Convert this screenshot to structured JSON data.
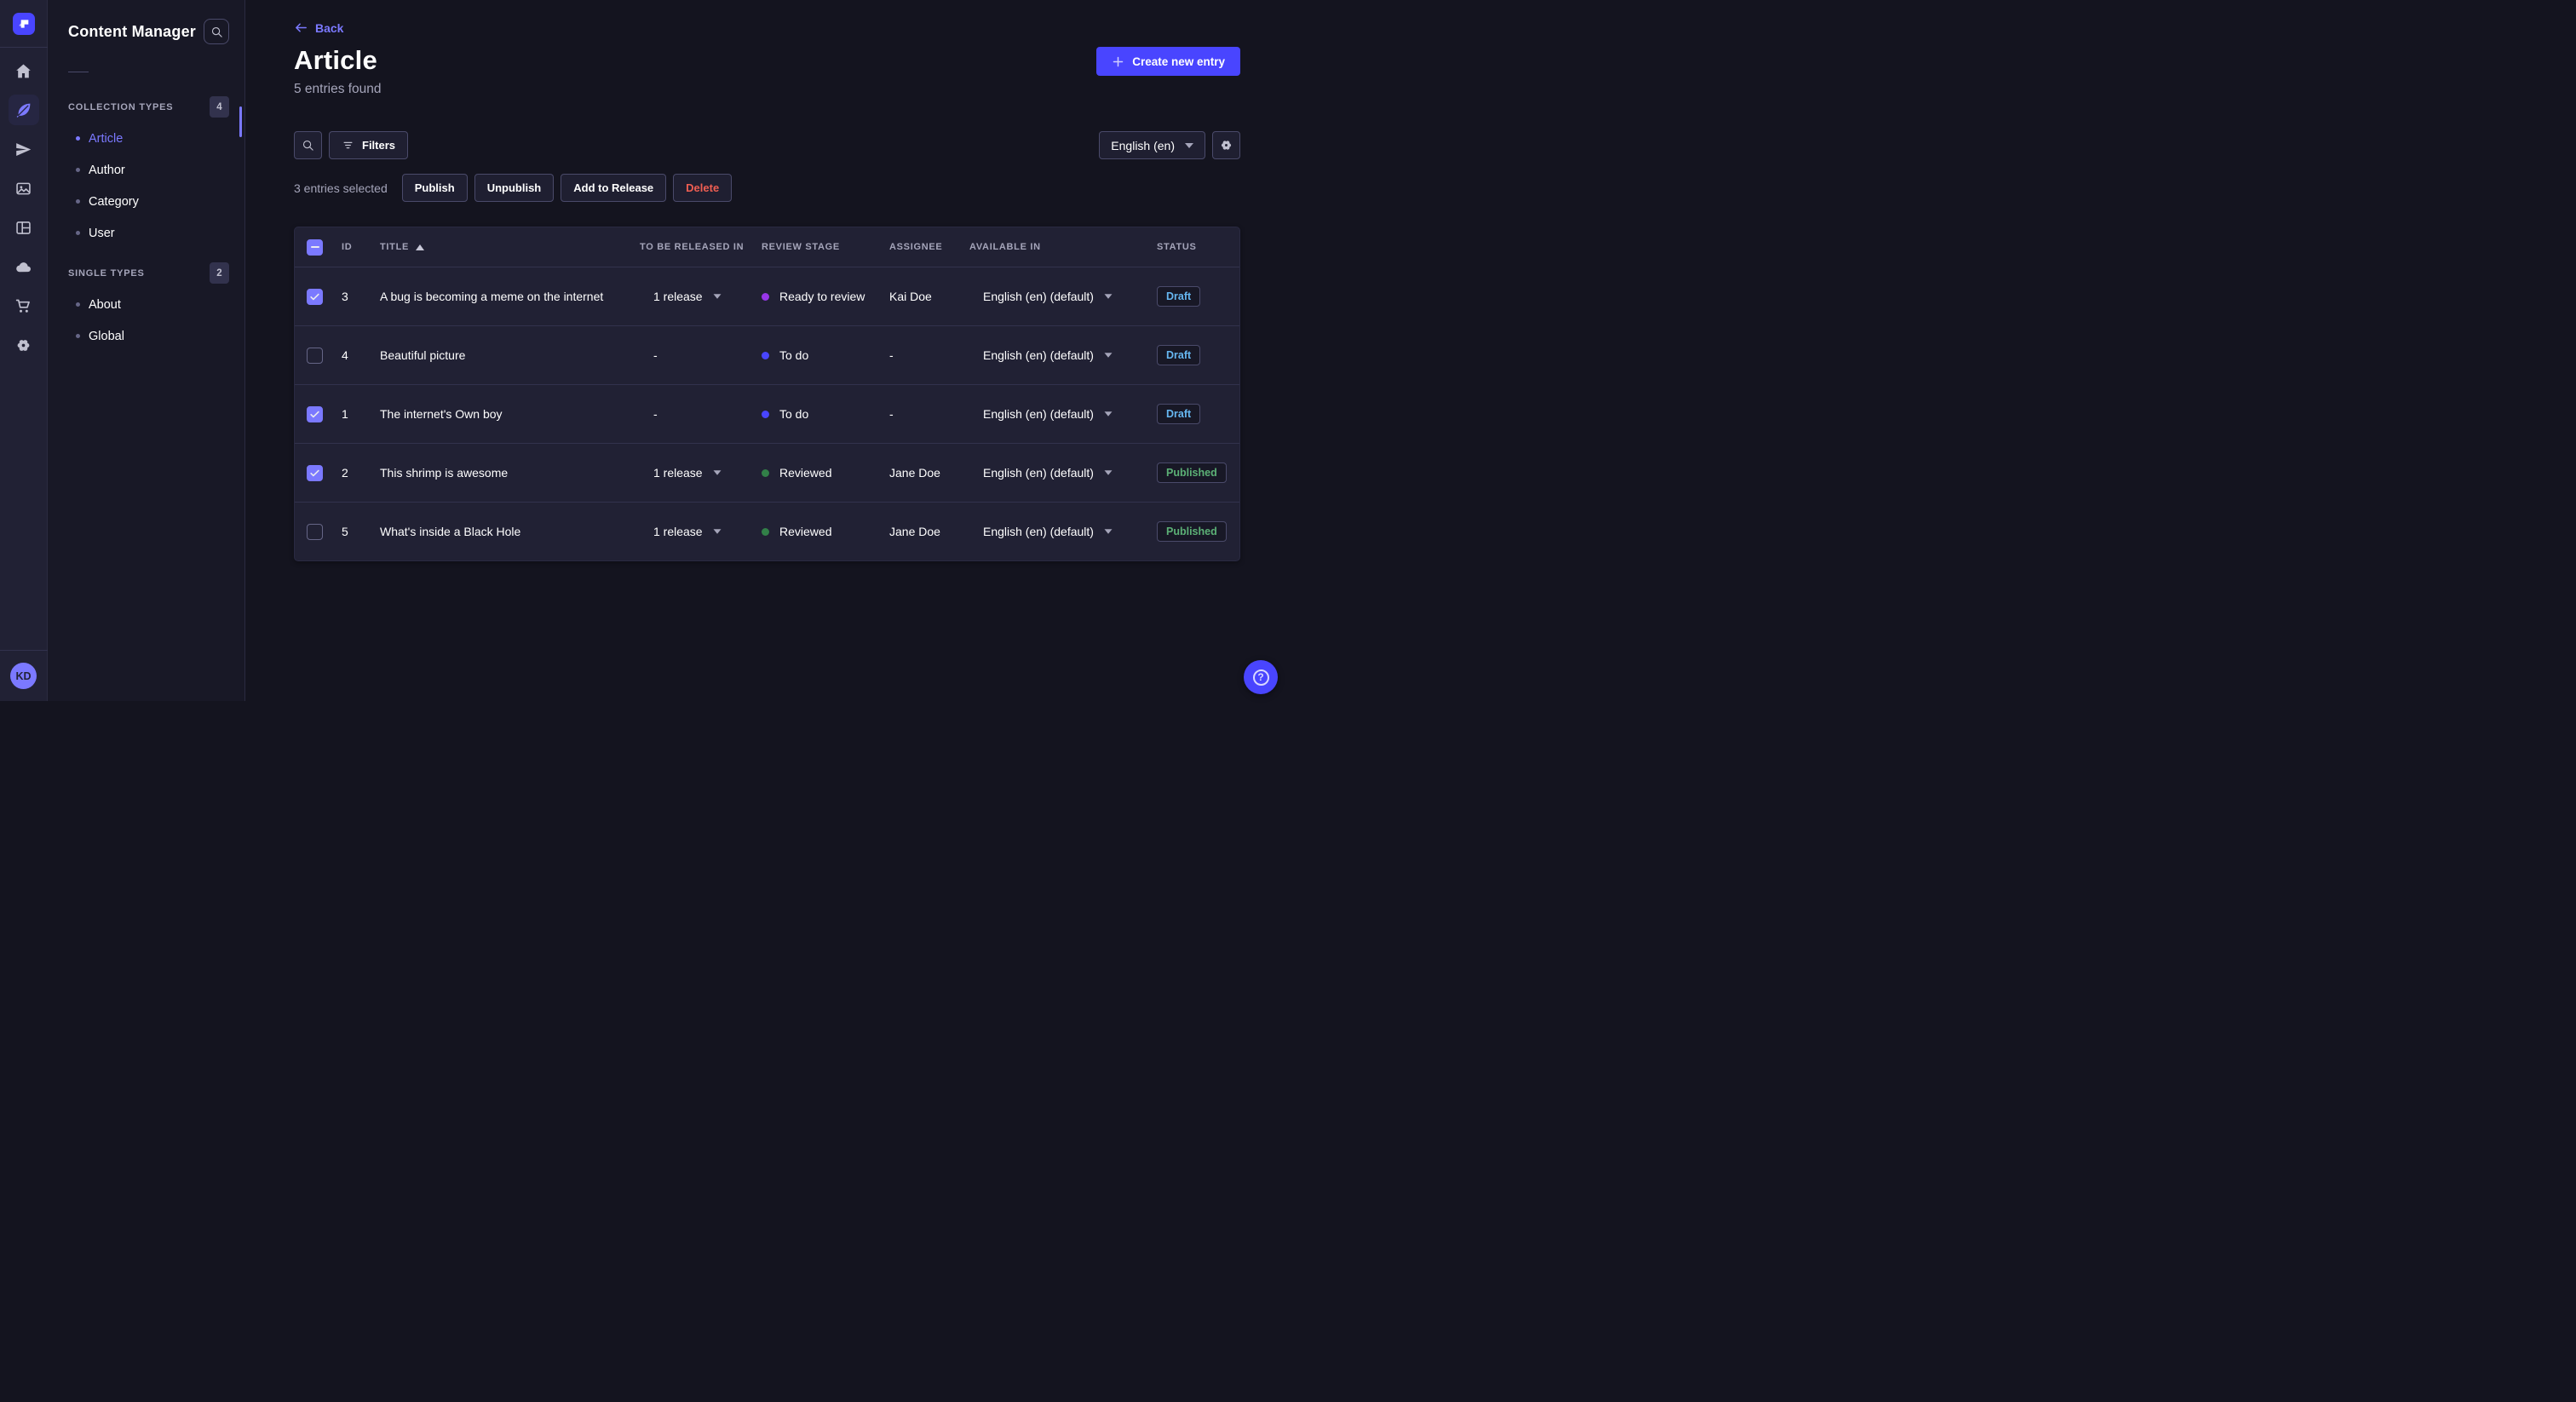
{
  "subnav": {
    "title": "Content Manager",
    "sections": [
      {
        "label": "COLLECTION TYPES",
        "badge": "4",
        "items": [
          {
            "label": "Article",
            "active": true
          },
          {
            "label": "Author",
            "active": false
          },
          {
            "label": "Category",
            "active": false
          },
          {
            "label": "User",
            "active": false
          }
        ]
      },
      {
        "label": "SINGLE TYPES",
        "badge": "2",
        "items": [
          {
            "label": "About",
            "active": false
          },
          {
            "label": "Global",
            "active": false
          }
        ]
      }
    ]
  },
  "rail": {
    "avatar_initials": "KD"
  },
  "header": {
    "back_label": "Back",
    "title": "Article",
    "subtitle": "5 entries found",
    "create_label": "Create new entry"
  },
  "toolbar": {
    "filters_label": "Filters",
    "locale_value": "English (en)"
  },
  "selection": {
    "text": "3 entries selected",
    "publish_label": "Publish",
    "unpublish_label": "Unpublish",
    "add_release_label": "Add to Release",
    "delete_label": "Delete"
  },
  "table": {
    "columns": [
      "ID",
      "TITLE",
      "TO BE RELEASED IN",
      "REVIEW STAGE",
      "ASSIGNEE",
      "AVAILABLE IN",
      "STATUS"
    ],
    "rows": [
      {
        "selected": true,
        "id": "3",
        "title": "A bug is becoming a meme on the internet",
        "release": "1 release",
        "release_menu": true,
        "stage": "Ready to review",
        "stage_color": "#9736e8",
        "assignee": "Kai Doe",
        "locale": "English (en) (default)",
        "status": "Draft"
      },
      {
        "selected": false,
        "id": "4",
        "title": "Beautiful picture",
        "release": "-",
        "release_menu": false,
        "stage": "To do",
        "stage_color": "#4945ff",
        "assignee": "-",
        "locale": "English (en) (default)",
        "status": "Draft"
      },
      {
        "selected": true,
        "id": "1",
        "title": "The internet's Own boy",
        "release": "-",
        "release_menu": false,
        "stage": "To do",
        "stage_color": "#4945ff",
        "assignee": "-",
        "locale": "English (en) (default)",
        "status": "Draft"
      },
      {
        "selected": true,
        "id": "2",
        "title": "This shrimp is awesome",
        "release": "1 release",
        "release_menu": true,
        "stage": "Reviewed",
        "stage_color": "#328048",
        "assignee": "Jane Doe",
        "locale": "English (en) (default)",
        "status": "Published"
      },
      {
        "selected": false,
        "id": "5",
        "title": "What's inside a Black Hole",
        "release": "1 release",
        "release_menu": true,
        "stage": "Reviewed",
        "stage_color": "#328048",
        "assignee": "Jane Doe",
        "locale": "English (en) (default)",
        "status": "Published"
      }
    ]
  },
  "colors": {
    "primary": "#4945ff",
    "primary_light": "#7b79ff",
    "draft_text": "#66b7f1",
    "published_text": "#5cb176",
    "danger_text": "#ee5e52"
  }
}
